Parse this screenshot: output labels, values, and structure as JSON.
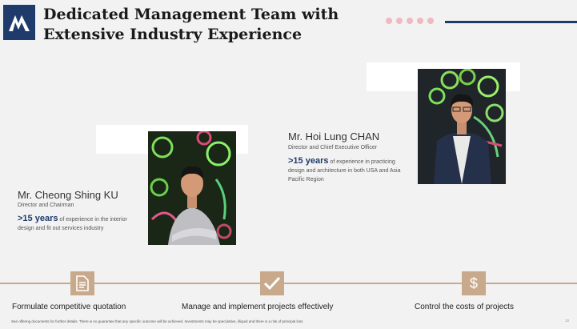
{
  "slide": {
    "title_line1": "Dedicated Management Team with",
    "title_line2": "Extensive Industry Experience",
    "page_number": "10"
  },
  "colors": {
    "navy": "#1f3b6b",
    "tan": "#c8a98c",
    "dot_pink": "#f0b9c0",
    "background": "#f2f2f2"
  },
  "people": [
    {
      "name": "Mr. Cheong Shing KU",
      "role": "Director and Chairman",
      "years": ">15 years",
      "description": "of experience in the interior design and fit out services industry"
    },
    {
      "name": "Mr. Hoi Lung CHAN",
      "role": "Director and Chief Executive Officer",
      "years": ">15 years",
      "description": "of experience in practicing design and architecture in both USA and Asia Pacific Region"
    }
  ],
  "timeline": [
    {
      "label": "Formulate competitive quotation",
      "icon": "document-icon"
    },
    {
      "label": "Manage and implement projects effectively",
      "icon": "checkmark-icon"
    },
    {
      "label": "Control the costs of projects",
      "icon": "dollar-icon"
    }
  ],
  "disclaimer": "See offering documents for further details. There is no guarantee that any specific outcome will be achieved. Investments may be speculative, illiquid and there is a risk of principal loss"
}
